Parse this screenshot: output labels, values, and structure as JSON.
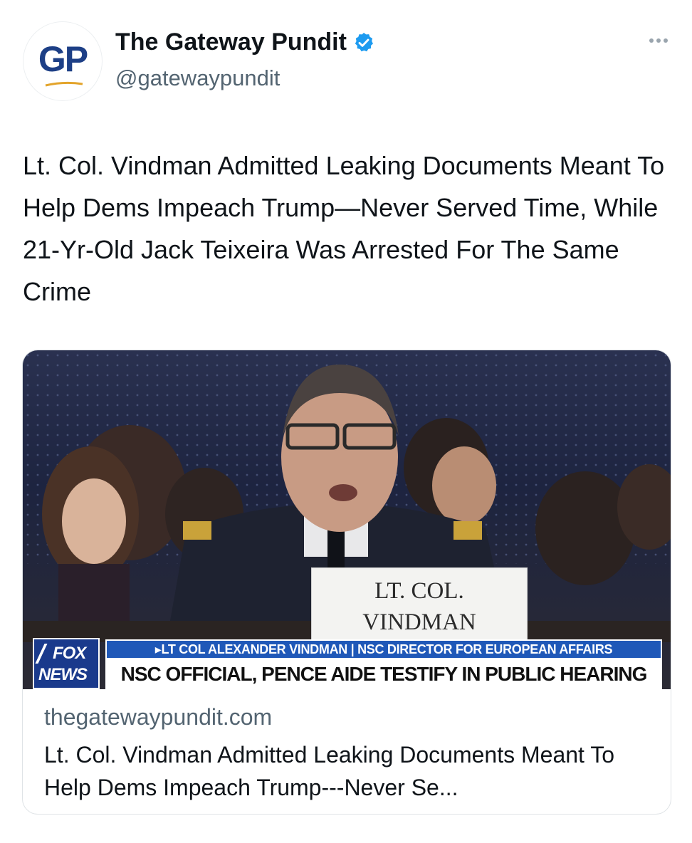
{
  "account": {
    "avatar_text": "GP",
    "display_name": "The Gateway Pundit",
    "handle": "@gatewaypundit",
    "verified_icon": "verified-badge-icon",
    "more_icon": "more-options-icon"
  },
  "tweet": {
    "text": "Lt. Col. Vindman Admitted Leaking Documents Meant To Help Dems Impeach Trump—Never Served Time, While 21-Yr-Old Jack Teixeira Was Arrested For The Same Crime"
  },
  "card": {
    "image": {
      "sign_line1": "LT. COL.",
      "sign_line2": "VINDMAN",
      "logo_line1": "FOX",
      "logo_line2": "NEWS",
      "chyron_top": "▸LT COL ALEXANDER VINDMAN | NSC DIRECTOR FOR EUROPEAN AFFAIRS",
      "chyron_main": "NSC OFFICIAL, PENCE AIDE TESTIFY IN PUBLIC HEARING"
    },
    "domain": "thegatewaypundit.com",
    "title": "Lt. Col. Vindman Admitted Leaking Documents Meant To Help Dems Impeach Trump---Never Se..."
  },
  "colors": {
    "accent_blue": "#1d9bf0",
    "text_primary": "#0f1419",
    "text_secondary": "#536471",
    "fox_blue": "#1a3a8c"
  }
}
